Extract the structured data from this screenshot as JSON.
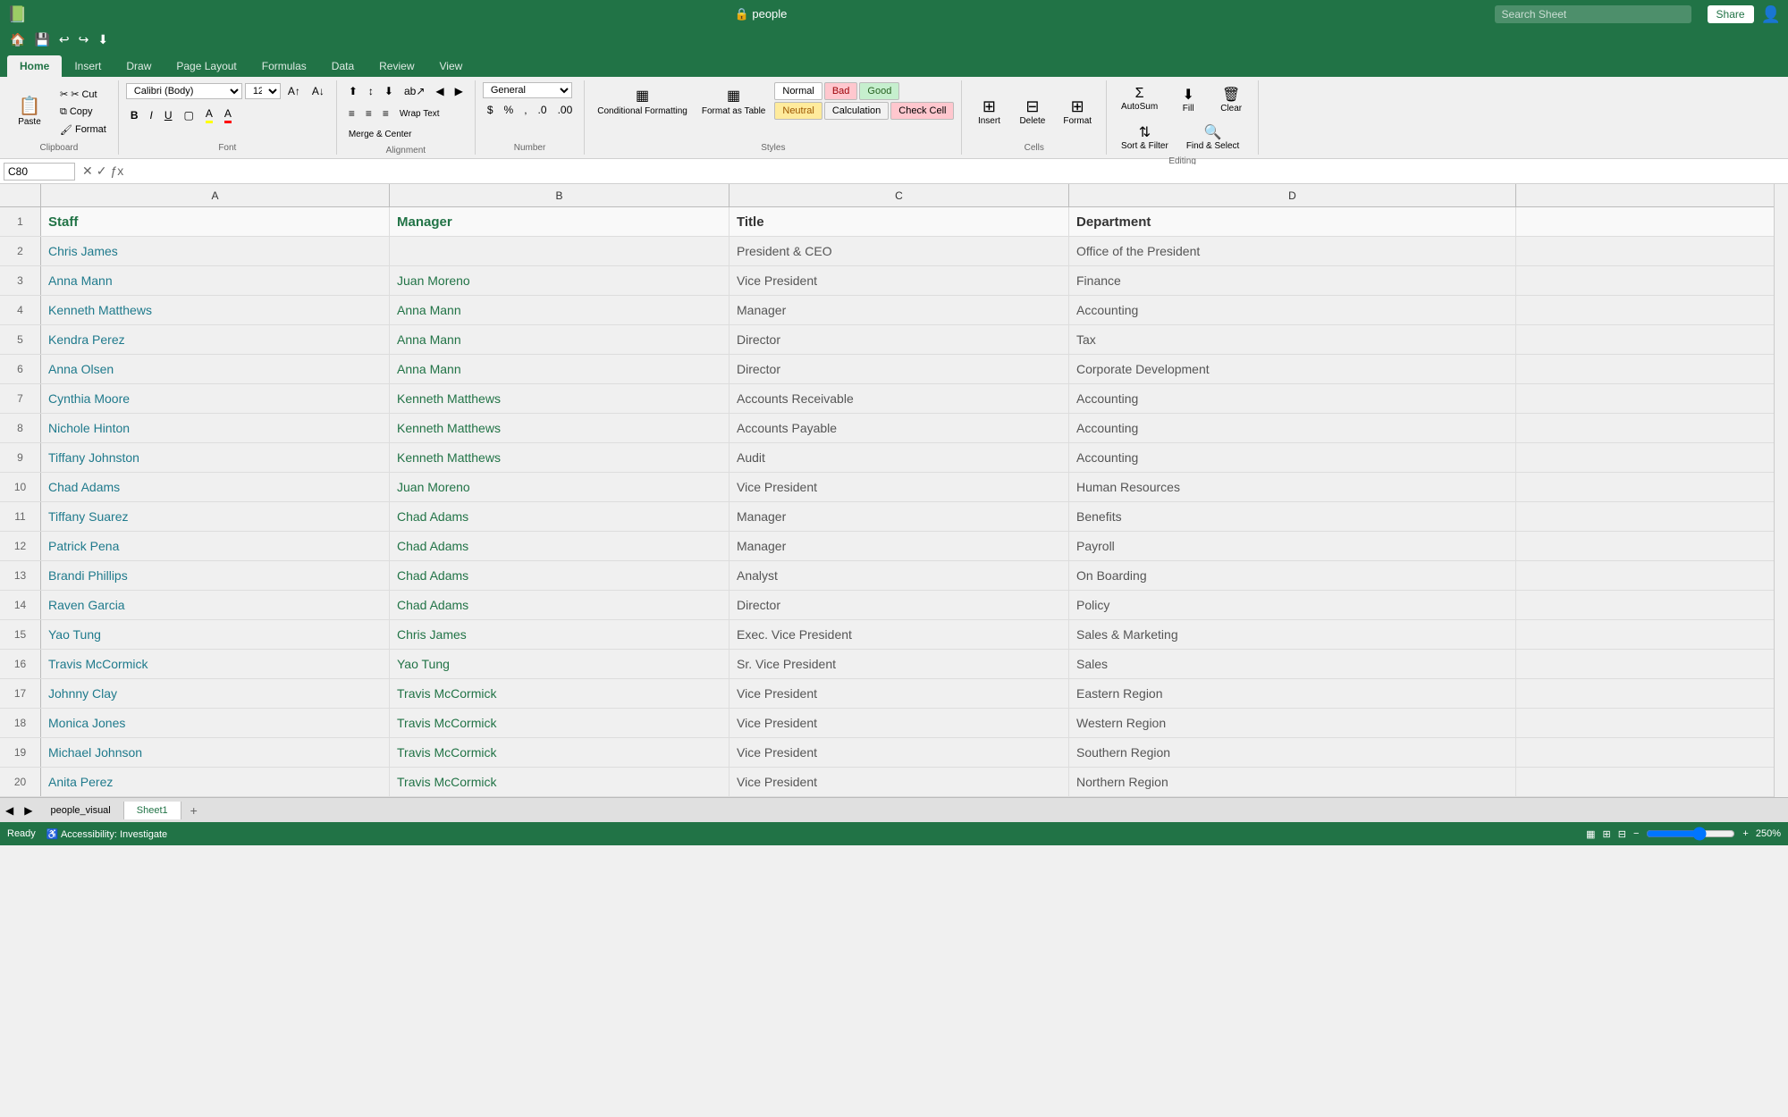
{
  "titleBar": {
    "appIcon": "📗",
    "fileName": "people",
    "searchPlaceholder": "Search Sheet",
    "shareLabel": "Share"
  },
  "quickAccess": {
    "buttons": [
      "🏠",
      "💾",
      "↩",
      "↪",
      "⬇"
    ]
  },
  "ribbonTabs": {
    "tabs": [
      "Home",
      "Insert",
      "Draw",
      "Page Layout",
      "Formulas",
      "Data",
      "Review",
      "View"
    ],
    "activeTab": "Home"
  },
  "ribbon": {
    "clipboard": {
      "paste": "Paste",
      "cut": "✂ Cut",
      "copy": "Copy",
      "format": "Format"
    },
    "font": {
      "fontName": "Calibri (Body)",
      "fontSize": "12",
      "boldLabel": "B",
      "italicLabel": "I",
      "underlineLabel": "U"
    },
    "alignment": {
      "wrapText": "Wrap Text",
      "mergeCenter": "Merge & Center"
    },
    "number": {
      "format": "General"
    },
    "styles": {
      "conditionalFormat": "Conditional Formatting",
      "formatAsTable": "Format as Table",
      "normal": "Normal",
      "bad": "Bad",
      "good": "Good",
      "neutral": "Neutral",
      "calculation": "Calculation",
      "checkCell": "Check Cell"
    },
    "cells": {
      "insert": "Insert",
      "delete": "Delete",
      "format": "Format"
    },
    "editing": {
      "autoSum": "AutoSum",
      "fill": "Fill",
      "clear": "Clear",
      "sortFilter": "Sort & Filter",
      "findSelect": "Find & Select"
    }
  },
  "formulaBar": {
    "nameBox": "C80",
    "formula": ""
  },
  "columns": {
    "rowHeader": "",
    "A": "A",
    "B": "B",
    "C": "C",
    "D": "D"
  },
  "headers": {
    "staff": "Staff",
    "manager": "Manager",
    "title": "Title",
    "department": "Department"
  },
  "rows": [
    {
      "num": "2",
      "staff": "Chris James",
      "manager": "",
      "title": "President & CEO",
      "dept": "Office of the President"
    },
    {
      "num": "3",
      "staff": "Anna Mann",
      "manager": "Juan Moreno",
      "title": "Vice President",
      "dept": "Finance"
    },
    {
      "num": "4",
      "staff": "Kenneth Matthews",
      "manager": "Anna Mann",
      "title": "Manager",
      "dept": "Accounting"
    },
    {
      "num": "5",
      "staff": "Kendra Perez",
      "manager": "Anna Mann",
      "title": "Director",
      "dept": "Tax"
    },
    {
      "num": "6",
      "staff": "Anna Olsen",
      "manager": "Anna Mann",
      "title": "Director",
      "dept": "Corporate Development"
    },
    {
      "num": "7",
      "staff": "Cynthia Moore",
      "manager": "Kenneth Matthews",
      "title": "Accounts Receivable",
      "dept": "Accounting"
    },
    {
      "num": "8",
      "staff": "Nichole Hinton",
      "manager": "Kenneth Matthews",
      "title": "Accounts Payable",
      "dept": "Accounting"
    },
    {
      "num": "9",
      "staff": "Tiffany Johnston",
      "manager": "Kenneth Matthews",
      "title": "Audit",
      "dept": "Accounting"
    },
    {
      "num": "10",
      "staff": "Chad Adams",
      "manager": "Juan Moreno",
      "title": "Vice President",
      "dept": "Human Resources"
    },
    {
      "num": "11",
      "staff": "Tiffany Suarez",
      "manager": "Chad Adams",
      "title": "Manager",
      "dept": "Benefits"
    },
    {
      "num": "12",
      "staff": "Patrick Pena",
      "manager": "Chad Adams",
      "title": "Manager",
      "dept": "Payroll"
    },
    {
      "num": "13",
      "staff": "Brandi Phillips",
      "manager": "Chad Adams",
      "title": "Analyst",
      "dept": "On Boarding"
    },
    {
      "num": "14",
      "staff": "Raven Garcia",
      "manager": "Chad Adams",
      "title": "Director",
      "dept": "Policy"
    },
    {
      "num": "15",
      "staff": "Yao Tung",
      "manager": "Chris James",
      "title": "Exec. Vice President",
      "dept": "Sales & Marketing"
    },
    {
      "num": "16",
      "staff": "Travis McCormick",
      "manager": "Yao Tung",
      "title": "Sr. Vice President",
      "dept": "Sales"
    },
    {
      "num": "17",
      "staff": "Johnny Clay",
      "manager": "Travis McCormick",
      "title": "Vice President",
      "dept": "Eastern Region"
    },
    {
      "num": "18",
      "staff": "Monica Jones",
      "manager": "Travis McCormick",
      "title": "Vice President",
      "dept": "Western Region"
    },
    {
      "num": "19",
      "staff": "Michael Johnson",
      "manager": "Travis McCormick",
      "title": "Vice President",
      "dept": "Southern Region"
    },
    {
      "num": "20",
      "staff": "Anita Perez",
      "manager": "Travis McCormick",
      "title": "Vice President",
      "dept": "Northern Region"
    }
  ],
  "sheetTabs": {
    "tabs": [
      "people_visual",
      "Sheet1"
    ],
    "activeTab": "Sheet1",
    "addLabel": "+"
  },
  "statusBar": {
    "ready": "Ready",
    "accessibility": "Accessibility: Investigate",
    "normalView": "▦",
    "pageBreak": "▨",
    "pageLayout": "▤",
    "zoomOut": "-",
    "zoomLevel": "250%",
    "zoomIn": "+"
  }
}
